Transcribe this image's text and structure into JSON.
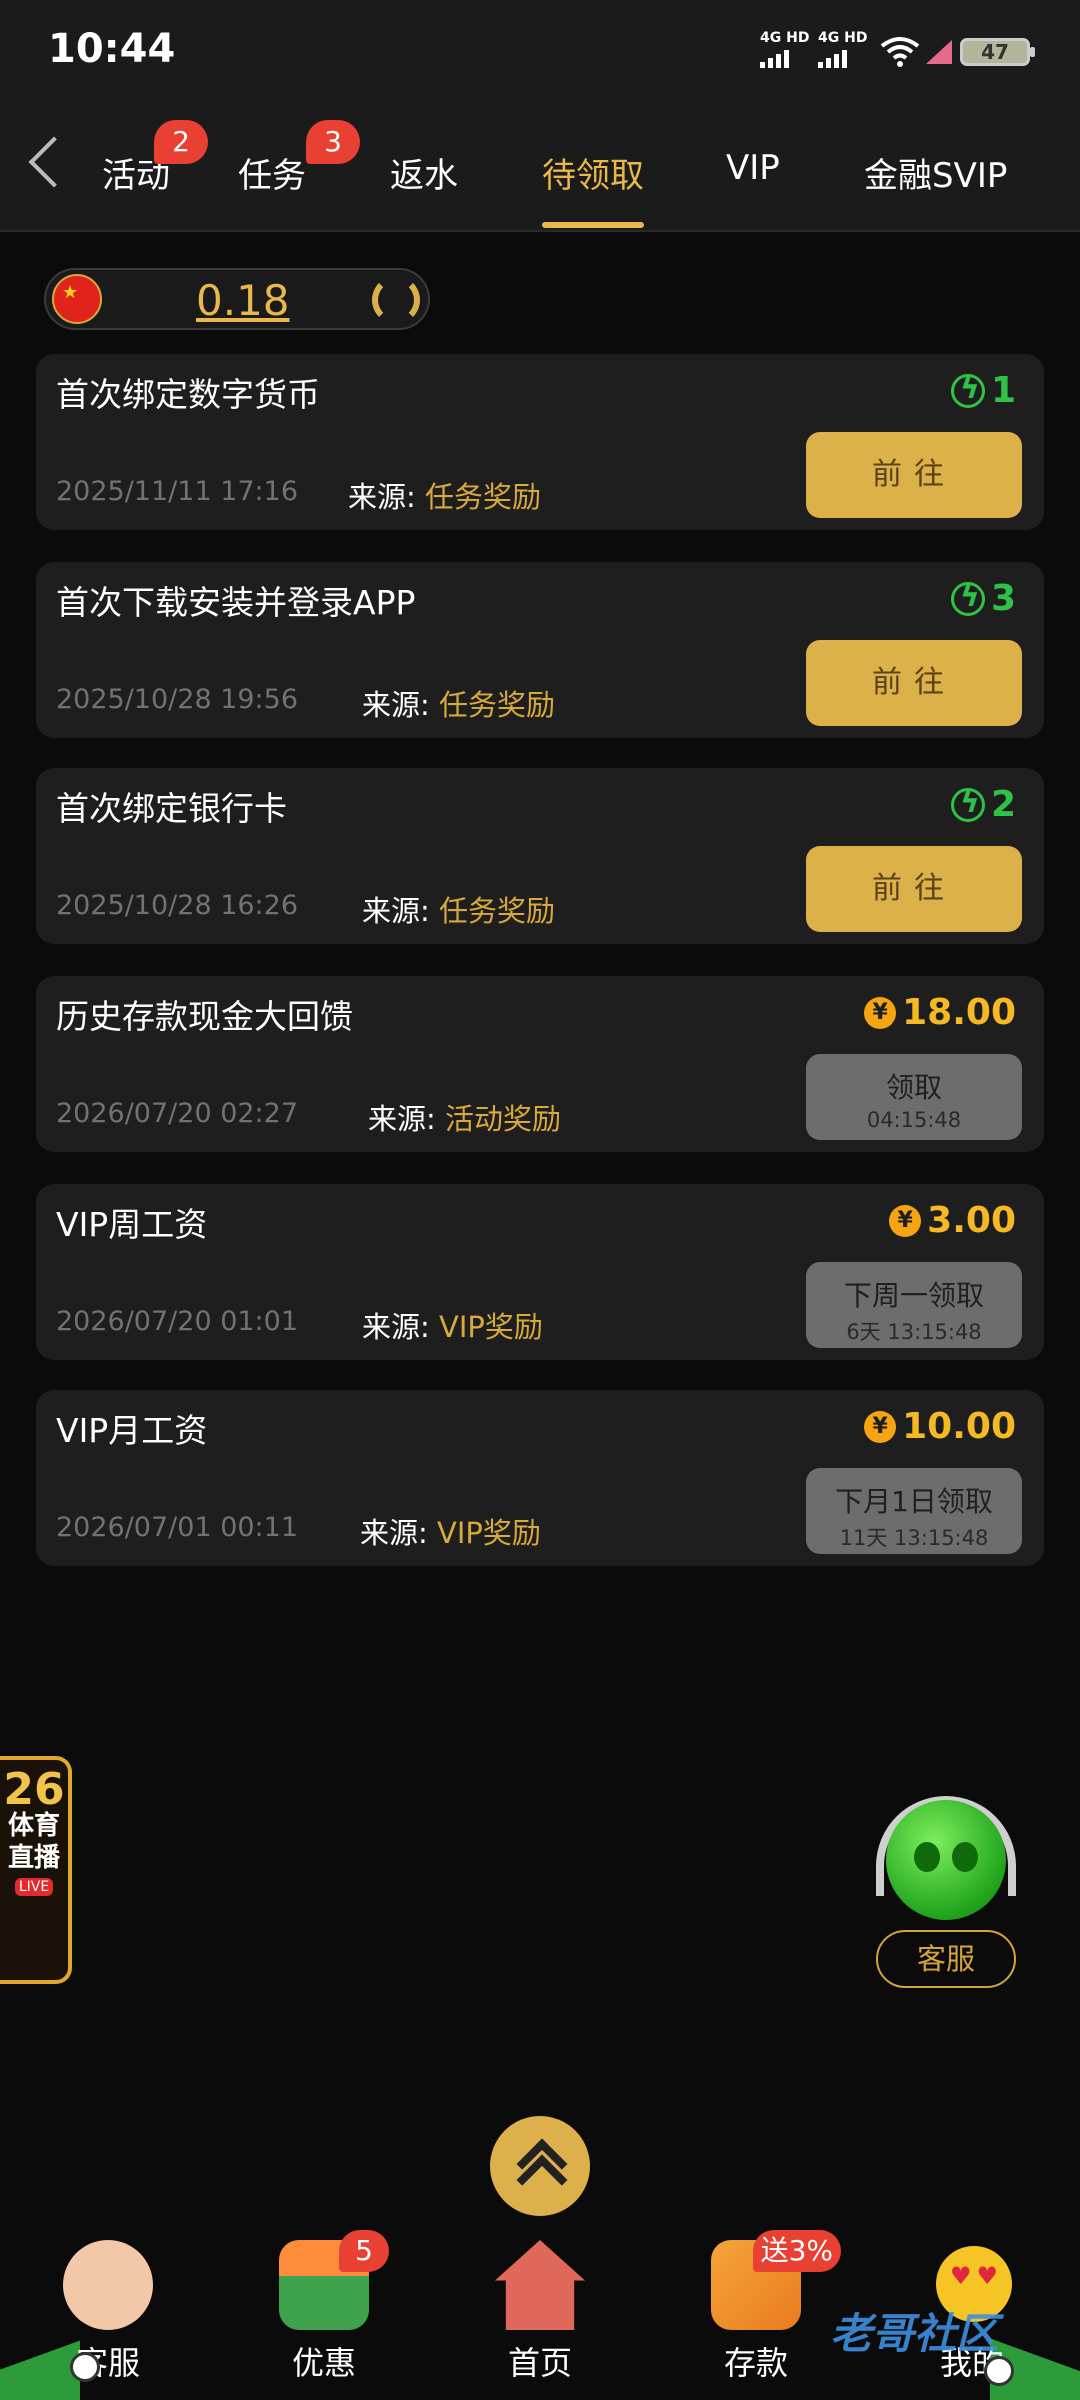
{
  "status_bar": {
    "time": "10:44",
    "network1": "4G HD",
    "network2": "4G HD",
    "battery": "47"
  },
  "tabs": [
    {
      "label": "活动",
      "badge": "2"
    },
    {
      "label": "任务",
      "badge": "3"
    },
    {
      "label": "返水",
      "badge": ""
    },
    {
      "label": "待领取",
      "badge": ""
    },
    {
      "label": "VIP",
      "badge": ""
    },
    {
      "label": "金融SVIP",
      "badge": ""
    }
  ],
  "balance": {
    "value": "0.18"
  },
  "source_label": "来源:",
  "cards": [
    {
      "title": "首次绑定数字货币",
      "date": "2025/11/11 17:16",
      "source": "任务奖励",
      "reward": "1",
      "reward_type": "bolt",
      "button": "前往",
      "button_sub": "",
      "button_style": "go"
    },
    {
      "title": "首次下载安装并登录APP",
      "date": "2025/10/28 19:56",
      "source": "任务奖励",
      "reward": "3",
      "reward_type": "bolt",
      "button": "前往",
      "button_sub": "",
      "button_style": "go"
    },
    {
      "title": "首次绑定银行卡",
      "date": "2025/10/28 16:26",
      "source": "任务奖励",
      "reward": "2",
      "reward_type": "bolt",
      "button": "前往",
      "button_sub": "",
      "button_style": "go"
    },
    {
      "title": "历史存款现金大回馈",
      "date": "2026/07/20 02:27",
      "source": "活动奖励",
      "reward": "18.00",
      "reward_type": "coin",
      "button": "领取",
      "button_sub": "04:15:48",
      "button_style": "gray"
    },
    {
      "title": "VIP周工资",
      "date": "2026/07/20 01:01",
      "source": "VIP奖励",
      "reward": "3.00",
      "reward_type": "coin",
      "button": "下周一领取",
      "button_sub": "6天 13:15:48",
      "button_style": "gray"
    },
    {
      "title": "VIP月工资",
      "date": "2026/07/01 00:11",
      "source": "VIP奖励",
      "reward": "10.00",
      "reward_type": "coin",
      "button": "下月1日领取",
      "button_sub": "11天 13:15:48",
      "button_style": "gray"
    }
  ],
  "coin_symbol": "¥",
  "fifa_banner": {
    "number": "26",
    "line1": "体育",
    "line2": "直播",
    "live": "LIVE"
  },
  "customer_service_float": {
    "label": "客服"
  },
  "bottom_nav": [
    {
      "label": "客服",
      "badge": ""
    },
    {
      "label": "优惠",
      "badge": "5"
    },
    {
      "label": "首页",
      "badge": ""
    },
    {
      "label": "存款",
      "badge": "送3%"
    },
    {
      "label": "我的",
      "badge": ""
    }
  ],
  "watermark": "老哥社区",
  "colors": {
    "accent": "#e8b84a",
    "green": "#2ec247",
    "gold": "#f6b823",
    "badge": "#e84033"
  }
}
